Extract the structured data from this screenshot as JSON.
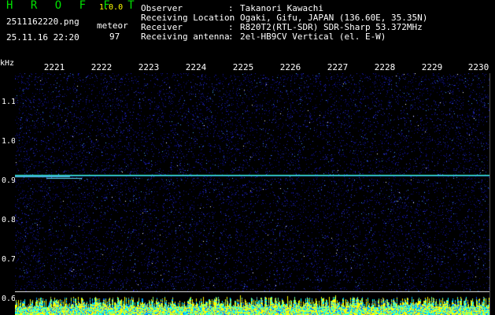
{
  "header": {
    "app_title": "H R O F F T",
    "app_version": "1.0.0",
    "filename": "2511162220.png",
    "datetime": "25.11.16 22:20",
    "type_label": "meteor",
    "count": "97"
  },
  "observation": {
    "observer_label": "Observer",
    "observer_value": "Takanori Kawachi",
    "location_label": "Receiving Location",
    "location_value": "Ogaki, Gifu, JAPAN (136.60E, 35.35N)",
    "receiver_label": "Receiver",
    "receiver_value": "R820T2(RTL-SDR) SDR-Sharp 53.372MHz",
    "antenna_label": "Receiving antenna",
    "antenna_value": "2el-HB9CV Vertical (el. E-W)",
    "separator": ":"
  },
  "axis": {
    "y_unit": "kHz",
    "y_ticks": [
      "1.1",
      "1.0",
      "0.9",
      "0.8",
      "0.7",
      "0.6"
    ],
    "x_ticks": [
      "2221",
      "2222",
      "2223",
      "2224",
      "2225",
      "2226",
      "2227",
      "2228",
      "2229",
      "2230"
    ]
  },
  "colors": {
    "background": "#000000",
    "noise_blue": "#1a1aa0",
    "carrier_line": "#00ffcc",
    "baseline_yellow": "#ffff00",
    "baseline_cyan": "#00ffff",
    "label_green": "#00e000",
    "label_white": "#ffffff"
  }
}
